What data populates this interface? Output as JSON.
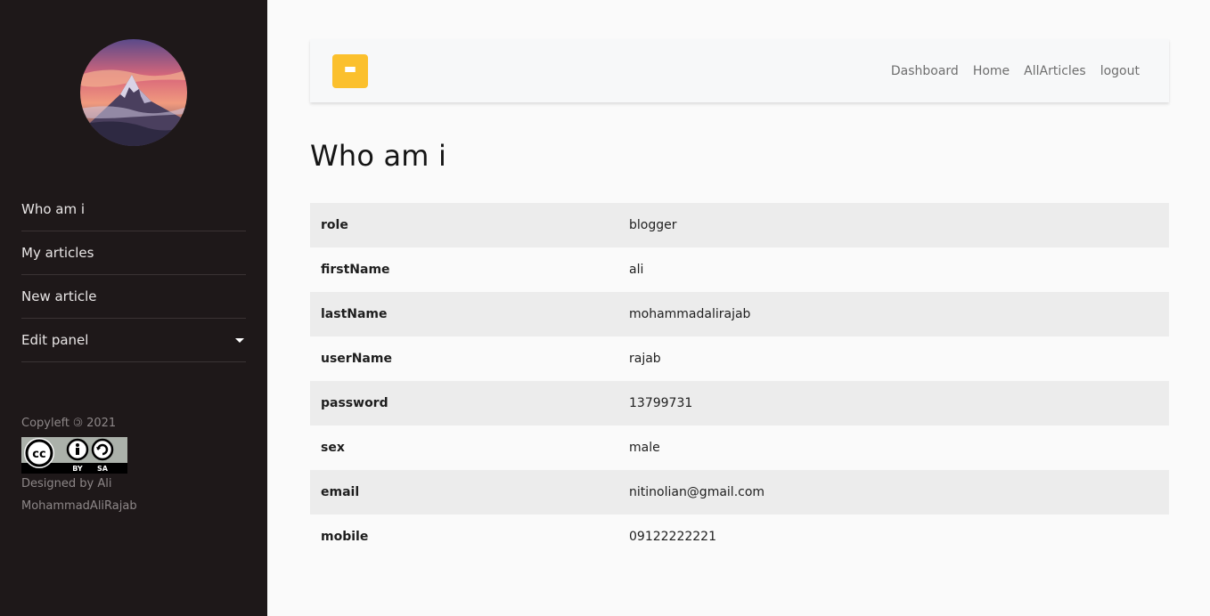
{
  "sidebar": {
    "avatar_alt": "mountain",
    "nav": [
      {
        "label": "Who am i"
      },
      {
        "label": "My articles"
      },
      {
        "label": "New article"
      },
      {
        "label": "Edit panel",
        "has_dropdown": true
      }
    ],
    "footer": {
      "copyleft": "Copyleft 🄯 2021",
      "license_badge": {
        "left": "BY",
        "right": "SA"
      },
      "designed_by": "Designed by Ali",
      "author": "MohammadAliRajab"
    }
  },
  "topbar": {
    "menu_icon": "hamburger-icon",
    "links": [
      "Dashboard",
      "Home",
      "AllArticles",
      "logout"
    ]
  },
  "main": {
    "title": "Who am i",
    "rows": [
      {
        "key": "role",
        "value": "blogger"
      },
      {
        "key": "firstName",
        "value": "ali"
      },
      {
        "key": "lastName",
        "value": "mohammadalirajab"
      },
      {
        "key": "userName",
        "value": "rajab"
      },
      {
        "key": "password",
        "value": "13799731"
      },
      {
        "key": "sex",
        "value": "male"
      },
      {
        "key": "email",
        "value": "nitinolian@gmail.com"
      },
      {
        "key": "mobile",
        "value": "09122222221"
      }
    ]
  },
  "colors": {
    "sidebar_bg": "#1e1819",
    "accent": "#fbc02d",
    "row_alt": "#ececec"
  }
}
